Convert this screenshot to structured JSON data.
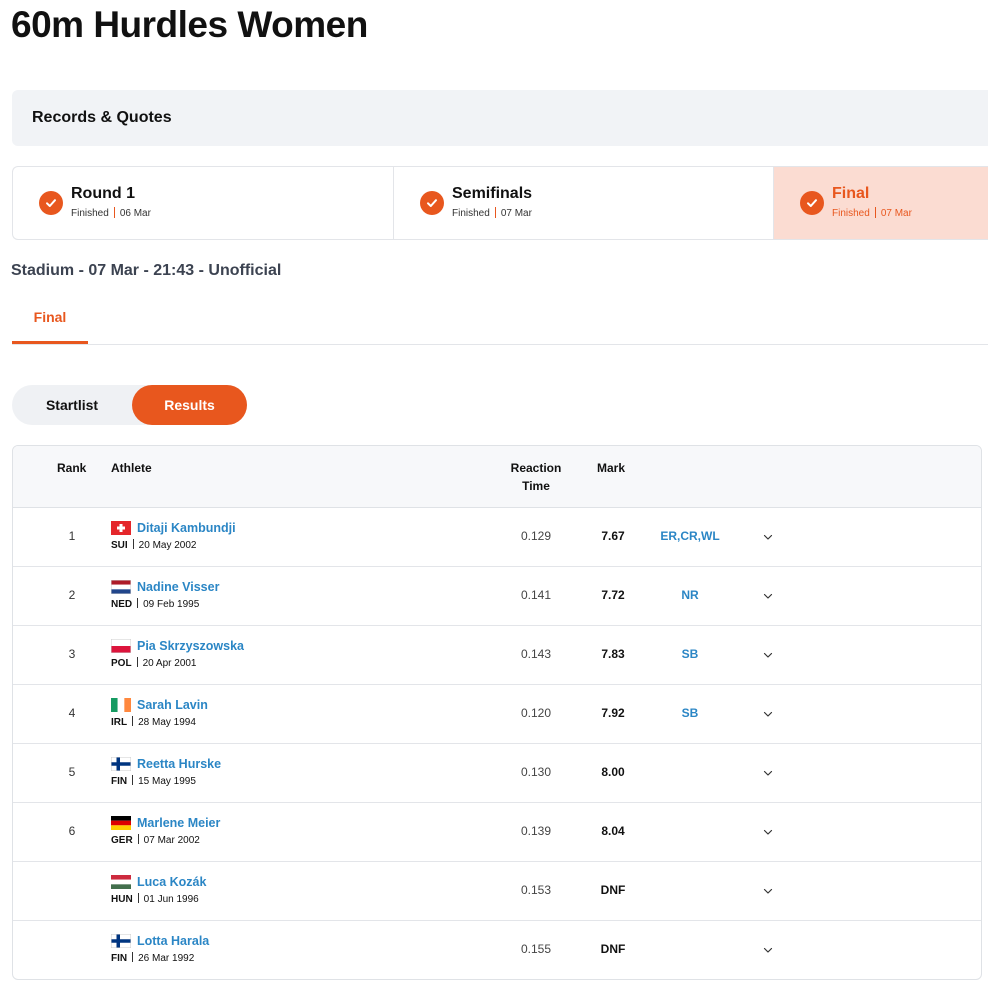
{
  "page": {
    "title": "60m Hurdles Women"
  },
  "records": {
    "label": "Records & Quotes"
  },
  "rounds": [
    {
      "name": "Round 1",
      "status": "Finished",
      "date": "06 Mar"
    },
    {
      "name": "Semifinals",
      "status": "Finished",
      "date": "07 Mar"
    },
    {
      "name": "Final",
      "status": "Finished",
      "date": "07 Mar"
    }
  ],
  "venue": "Stadium - 07 Mar - 21:43 - Unofficial",
  "tabs": {
    "final": "Final"
  },
  "toggle": {
    "startlist": "Startlist",
    "results": "Results"
  },
  "table": {
    "headers": {
      "rank": "Rank",
      "athlete": "Athlete",
      "reaction": "Reaction Time",
      "mark": "Mark"
    },
    "rows": [
      {
        "rank": "1",
        "name": "Ditaji Kambundji",
        "nat": "SUI",
        "dob": "20 May 2002",
        "reaction": "0.129",
        "mark": "7.67",
        "records": "ER,CR,WL",
        "flag": "sui"
      },
      {
        "rank": "2",
        "name": "Nadine Visser",
        "nat": "NED",
        "dob": "09 Feb 1995",
        "reaction": "0.141",
        "mark": "7.72",
        "records": "NR",
        "flag": "ned"
      },
      {
        "rank": "3",
        "name": "Pia Skrzyszowska",
        "nat": "POL",
        "dob": "20 Apr 2001",
        "reaction": "0.143",
        "mark": "7.83",
        "records": "SB",
        "flag": "pol"
      },
      {
        "rank": "4",
        "name": "Sarah Lavin",
        "nat": "IRL",
        "dob": "28 May 1994",
        "reaction": "0.120",
        "mark": "7.92",
        "records": "SB",
        "flag": "irl"
      },
      {
        "rank": "5",
        "name": "Reetta Hurske",
        "nat": "FIN",
        "dob": "15 May 1995",
        "reaction": "0.130",
        "mark": "8.00",
        "records": "",
        "flag": "fin"
      },
      {
        "rank": "6",
        "name": "Marlene Meier",
        "nat": "GER",
        "dob": "07 Mar 2002",
        "reaction": "0.139",
        "mark": "8.04",
        "records": "",
        "flag": "ger"
      },
      {
        "rank": "",
        "name": "Luca Kozák",
        "nat": "HUN",
        "dob": "01 Jun 1996",
        "reaction": "0.153",
        "mark": "DNF",
        "records": "",
        "flag": "hun"
      },
      {
        "rank": "",
        "name": "Lotta Harala",
        "nat": "FIN",
        "dob": "26 Mar 1992",
        "reaction": "0.155",
        "mark": "DNF",
        "records": "",
        "flag": "fin"
      }
    ]
  },
  "colors": {
    "accent": "#e8571e",
    "link": "#2b86c5",
    "active_round_bg": "#fbdcd2"
  }
}
